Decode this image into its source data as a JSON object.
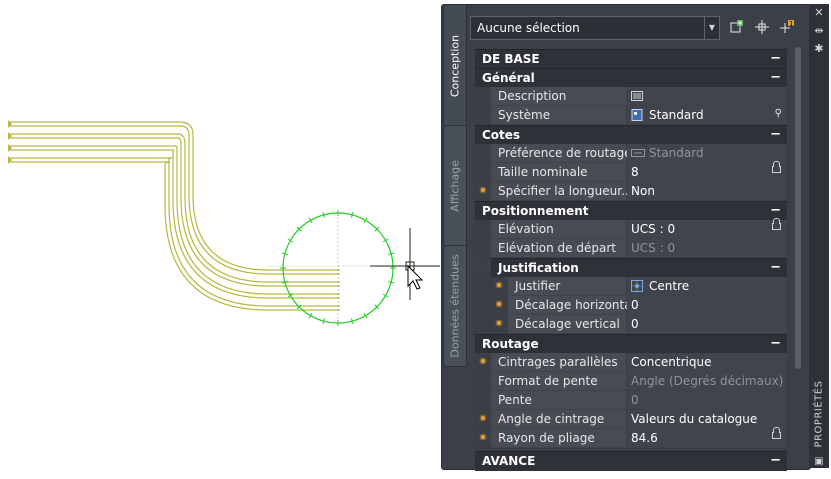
{
  "selection": {
    "value": "Aucune sélection"
  },
  "tabs": {
    "design": "Conception",
    "display": "Affichage",
    "extended": "Données étendues"
  },
  "toolbar": {
    "quick_select_icon": "quick-select-icon",
    "pick_icon": "pick-icon",
    "toggle_icon": "toggle-pickadd-icon"
  },
  "sections": {
    "base": "DE BASE",
    "general": "Général",
    "cotes": "Cotes",
    "positioning": "Positionnement",
    "justification": "Justification",
    "routing": "Routage",
    "advanced": "AVANCE"
  },
  "collapse_symbol": "−",
  "props": {
    "description": {
      "label": "Description",
      "value": ""
    },
    "system": {
      "label": "Système",
      "value": "Standard"
    },
    "routing_pref": {
      "label": "Préférence de routage",
      "value": "Standard"
    },
    "nominal_size": {
      "label": "Taille nominale",
      "value": "8"
    },
    "specify_length": {
      "label": "Spécifier la longueur...",
      "value": "Non"
    },
    "elevation": {
      "label": "Elévation",
      "value": "UCS : 0"
    },
    "start_elevation": {
      "label": "Elévation de départ",
      "value": "UCS : 0"
    },
    "justify": {
      "label": "Justifier",
      "value": "Centre"
    },
    "h_offset": {
      "label": "Décalage horizontal",
      "value": "0"
    },
    "v_offset": {
      "label": "Décalage vertical",
      "value": "0"
    },
    "parallel_bends": {
      "label": "Cintrages parallèles",
      "value": "Concentrique"
    },
    "slope_format": {
      "label": "Format de pente",
      "value": "Angle (Degrés décimaux)"
    },
    "slope": {
      "label": "Pente",
      "value": "0"
    },
    "bend_angle": {
      "label": "Angle de cintrage",
      "value": "Valeurs du catalogue"
    },
    "bend_radius": {
      "label": "Rayon de pliage",
      "value": "84.6"
    }
  },
  "palette_title": "PROPRIÉTÉS",
  "colors": {
    "pipe": "#b8b840",
    "circle": "#22cc22",
    "panel": "#3b4048",
    "accent": "#f0a030"
  }
}
